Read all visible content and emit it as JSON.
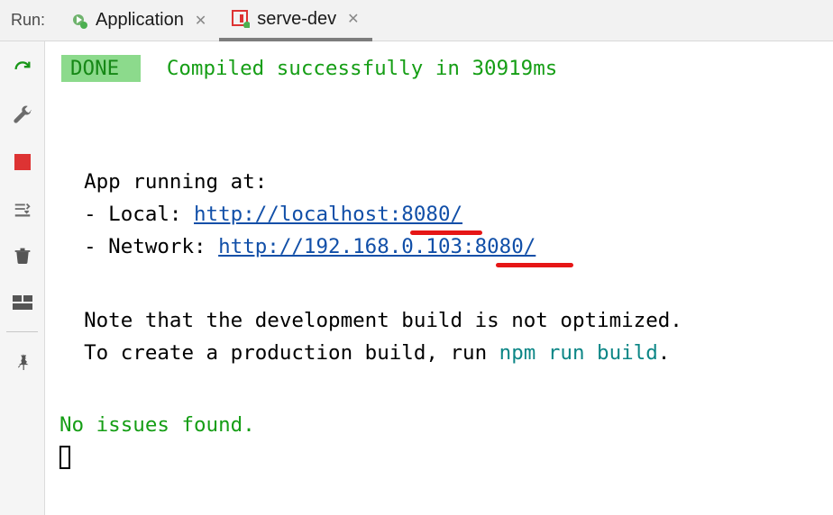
{
  "header": {
    "run_label": "Run:",
    "tabs": [
      {
        "label": "Application",
        "active": false
      },
      {
        "label": "serve-dev",
        "active": true
      }
    ]
  },
  "console": {
    "done_badge": " DONE ",
    "compiled_msg": "Compiled successfully in 30919ms",
    "app_running": "App running at:",
    "local_label": "- Local:   ",
    "local_url": "http://localhost:8080/",
    "network_label": "- Network: ",
    "network_url": "http://192.168.0.103:8080/",
    "note_line": "Note that the development build is not optimized.",
    "create_line_a": "To create a production build, run ",
    "create_cmd": "npm run build",
    "create_line_b": ".",
    "no_issues": "No issues found."
  }
}
